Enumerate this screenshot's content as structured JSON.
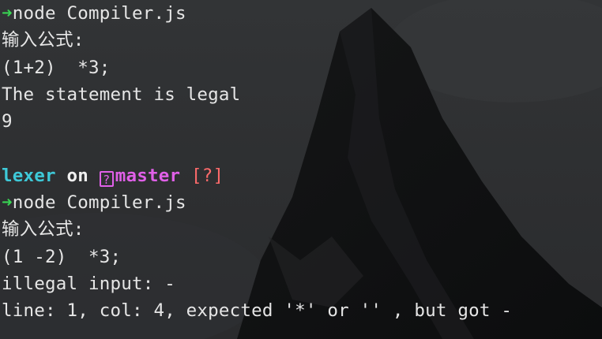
{
  "terminal": {
    "prompt_arrow": "➜",
    "prompt_dir": "lexer",
    "prompt_on": "on",
    "prompt_branch_icon": "?",
    "prompt_branch": "master",
    "prompt_status": "[?]",
    "command_1": "node Compiler.js",
    "input_prompt_1": "输入公式:",
    "formula_1": "(1+2)  *3;",
    "result_message_1": "The statement is legal",
    "result_value_1": "9",
    "command_2": "node Compiler.js",
    "input_prompt_2": "输入公式:",
    "formula_2": "(1 -2)  *3;",
    "error_message": "illegal input: -",
    "error_detail": "line: 1, col: 4, expected '*' or '' , but got -"
  },
  "colors": {
    "arrow": "#39d353",
    "dir": "#3ec9d8",
    "branch": "#e060e8",
    "status": "#ff6b6b",
    "text": "#e6e6e6"
  }
}
